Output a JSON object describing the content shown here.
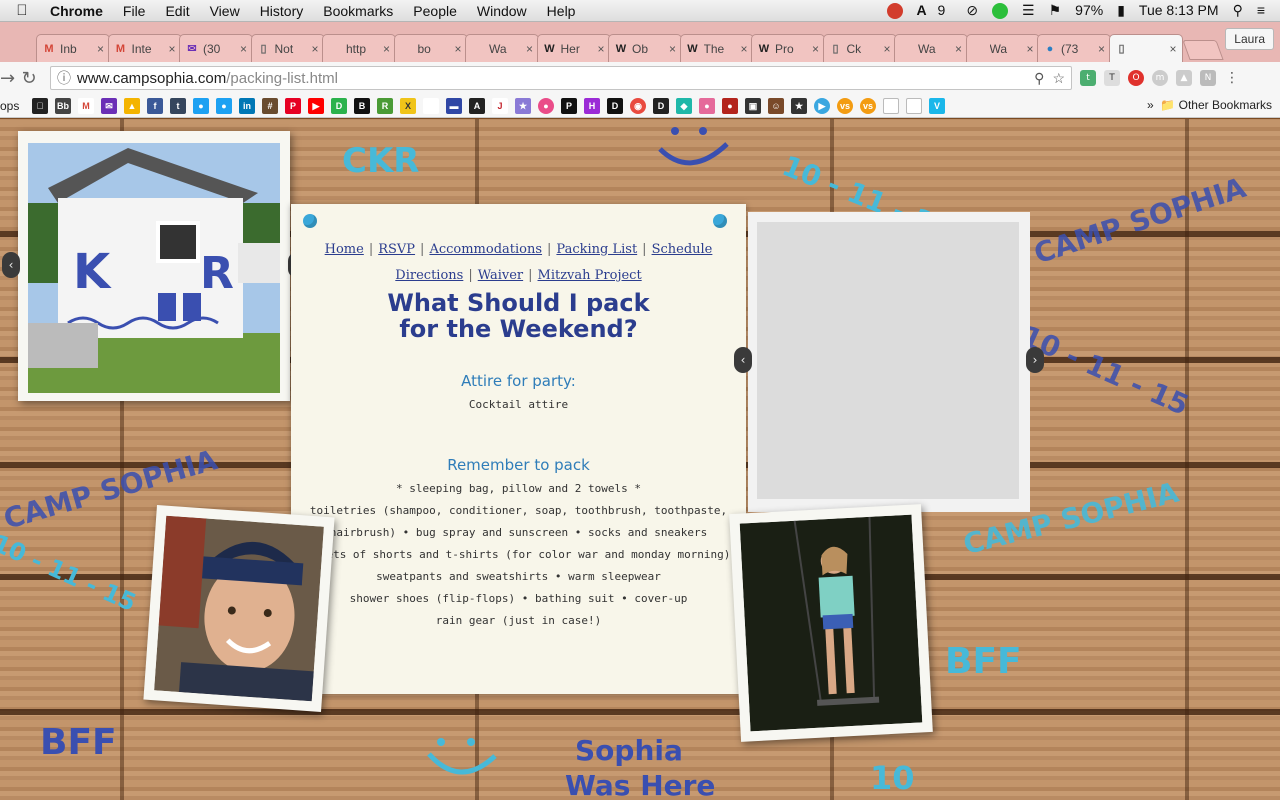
{
  "menubar": {
    "app": "Chrome",
    "items": [
      "File",
      "Edit",
      "View",
      "History",
      "Bookmarks",
      "People",
      "Window",
      "Help"
    ],
    "status": {
      "adobe_count": "9",
      "battery": "97%",
      "clock": "Tue 8:13 PM"
    }
  },
  "tabs": [
    {
      "title": "Inb",
      "icon": "M",
      "icon_color": "#d44638"
    },
    {
      "title": "Inte",
      "icon": "M",
      "icon_color": "#d44638"
    },
    {
      "title": "(30",
      "icon": "✉",
      "icon_color": "#6b2fb6"
    },
    {
      "title": "Not",
      "icon": "▯",
      "icon_color": "#666666"
    },
    {
      "title": "http",
      "icon": "",
      "icon_color": "#666666"
    },
    {
      "title": "bo",
      "icon": "",
      "icon_color": "#666666"
    },
    {
      "title": "Wa",
      "icon": "",
      "icon_color": "#666666"
    },
    {
      "title": "Her",
      "icon": "W",
      "icon_color": "#222222"
    },
    {
      "title": "Ob",
      "icon": "W",
      "icon_color": "#222222"
    },
    {
      "title": "The",
      "icon": "W",
      "icon_color": "#222222"
    },
    {
      "title": "Pro",
      "icon": "W",
      "icon_color": "#222222"
    },
    {
      "title": "Ck",
      "icon": "▯",
      "icon_color": "#666666"
    },
    {
      "title": "Wa",
      "icon": "",
      "icon_color": "#666666"
    },
    {
      "title": "Wa",
      "icon": "",
      "icon_color": "#666666"
    },
    {
      "title": "(73",
      "icon": "●",
      "icon_color": "#2a7fc4"
    },
    {
      "title": "",
      "icon": "▯",
      "icon_color": "#666666",
      "active": true
    }
  ],
  "profile": "Laura",
  "address": {
    "host": "www.campsophia.com",
    "path": "/packing-list.html"
  },
  "bookmarks": {
    "apps_label": "ops",
    "other_label": "Other Bookmarks"
  },
  "site": {
    "nav_row1": [
      "Home",
      "RSVP",
      "Accommodations",
      "Packing List",
      "Schedule"
    ],
    "nav_row2": [
      "Directions",
      "Waiver",
      "Mitzvah Project"
    ],
    "heading_line1": "What Should I pack",
    "heading_line2": "for the Weekend?",
    "attire_title": "Attire for party:",
    "attire_value": "Cocktail attire",
    "remember_title": "Remember to pack",
    "pack_lines": [
      "* sleeping bag, pillow and 2 towels *",
      "toiletries (shampoo, conditioner, soap, toothbrush, toothpaste,",
      "hairbrush) • bug spray and sunscreen • socks and sneakers",
      "2 sets of shorts and t-shirts (for color war and monday morning)",
      "sweatpants and sweatshirts • warm sleepwear",
      "shower shoes (flip-flops) • bathing suit • cover-up",
      "rain gear (just in case!)"
    ],
    "graffiti": {
      "ckr": "CKR",
      "date1": "10 - 11 - 15",
      "camp1": "CAMP SOPHIA",
      "camp2": "CAMP SOPHIA",
      "camp3": "CAMP SOPHIA",
      "date2": "10 - 11 - 15",
      "date3": "10 - 11 - 15",
      "bff1": "BFF",
      "bff2": "BFF",
      "sophia1": "Sophia",
      "sophia2": "Was Here",
      "ten": "10"
    },
    "colors": {
      "nav": "#2b3d8e",
      "accent": "#2f7db9",
      "graffiti_blue": "#3a4fb0",
      "graffiti_cyan": "#47b9d8"
    }
  }
}
